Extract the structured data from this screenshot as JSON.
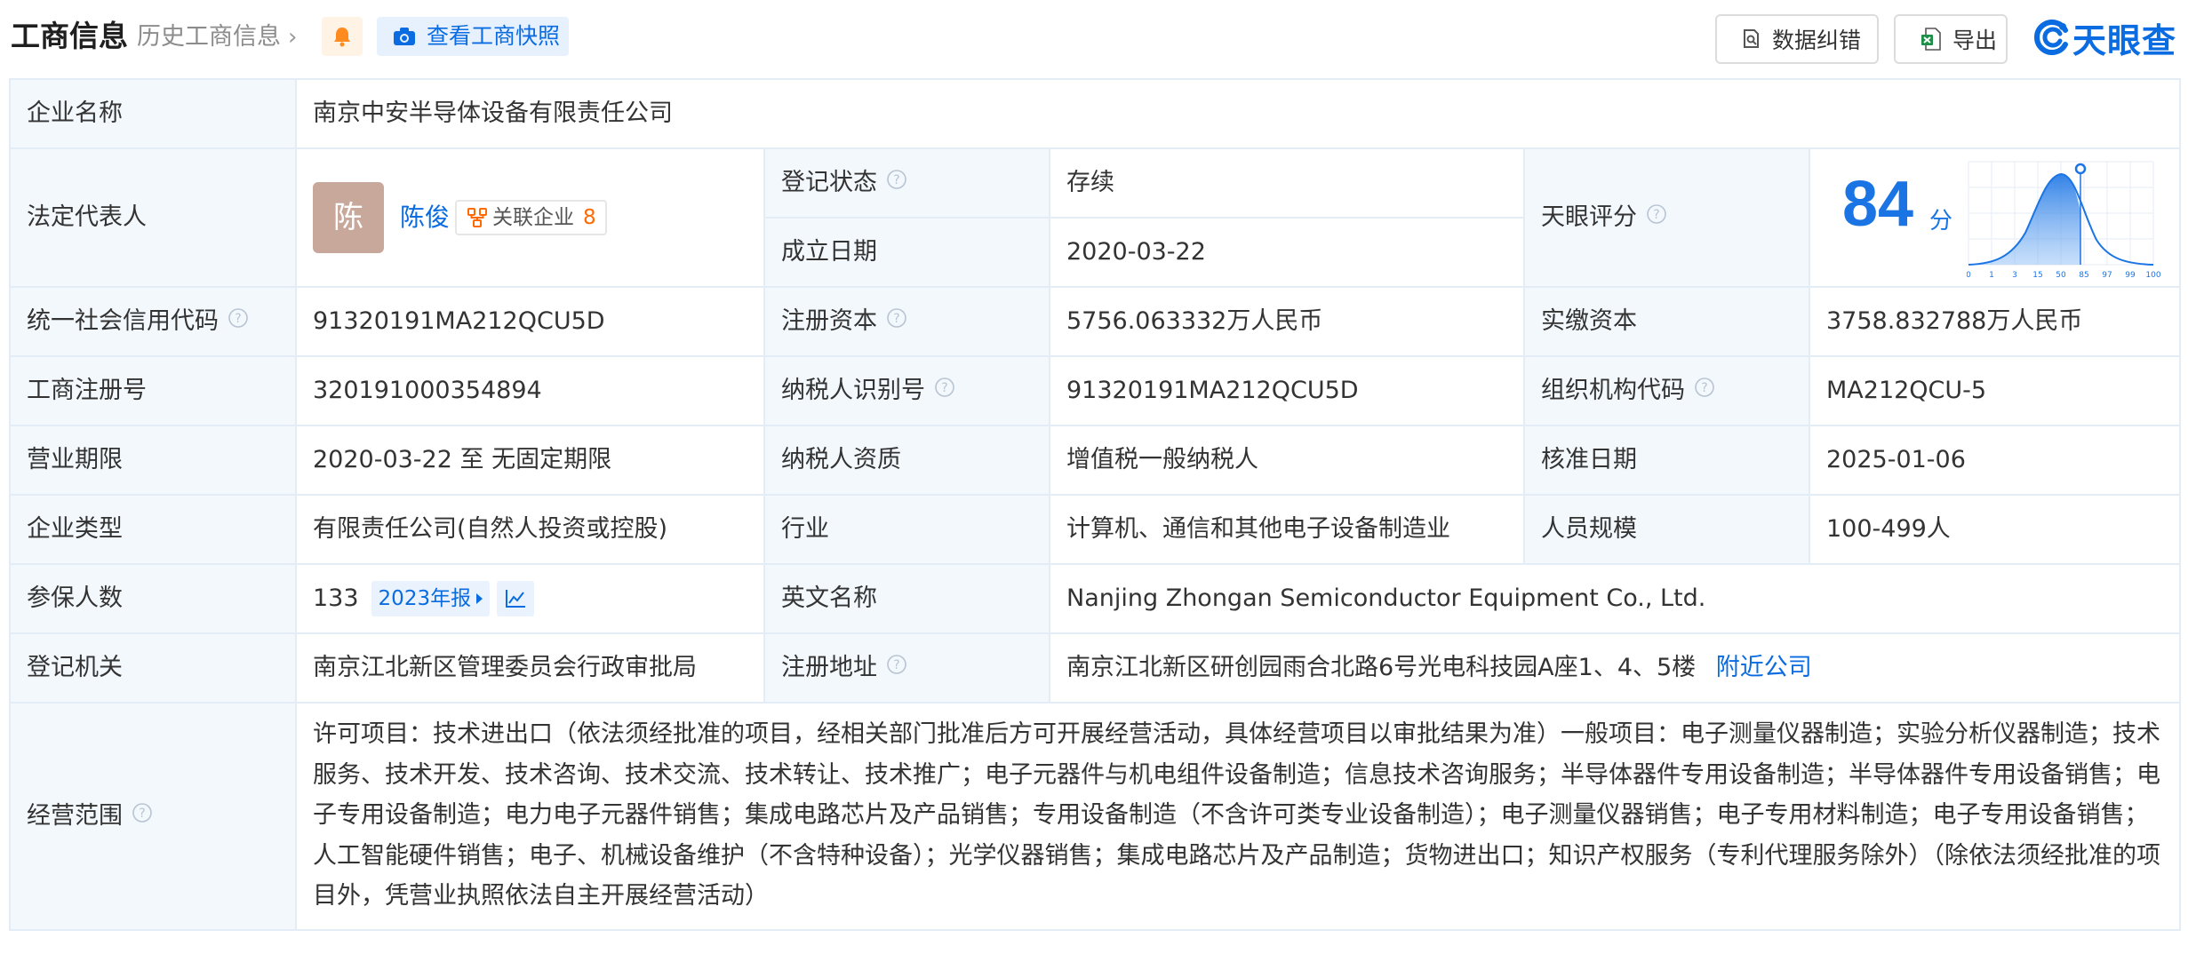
{
  "header": {
    "title": "工商信息",
    "history_link": "历史工商信息",
    "snapshot_button": "查看工商快照",
    "correct_button": "数据纠错",
    "export_button": "导出",
    "logo_text": "天眼查",
    "accent_color": "#0a6ce0",
    "icons": [
      "bell-icon",
      "camera-icon",
      "document-search-icon",
      "excel-icon",
      "tianyancha-logo-icon"
    ]
  },
  "company": {
    "name_label": "企业名称",
    "name": "南京中安半导体设备有限责任公司",
    "legal_rep_label": "法定代表人",
    "legal_rep_avatar": "陈",
    "legal_rep_name": "陈俊",
    "related_label": "关联企业",
    "related_count": "8",
    "reg_status_label": "登记状态",
    "reg_status": "存续",
    "found_date_label": "成立日期",
    "found_date": "2020-03-22",
    "score_label": "天眼评分",
    "score": "84",
    "score_unit": "分",
    "credit_code_label": "统一社会信用代码",
    "credit_code": "91320191MA212QCU5D",
    "reg_capital_label": "注册资本",
    "reg_capital": "5756.063332万人民币",
    "paid_capital_label": "实缴资本",
    "paid_capital": "3758.832788万人民币",
    "biz_reg_no_label": "工商注册号",
    "biz_reg_no": "320191000354894",
    "taxpayer_id_label": "纳税人识别号",
    "taxpayer_id": "91320191MA212QCU5D",
    "org_code_label": "组织机构代码",
    "org_code": "MA212QCU-5",
    "biz_term_label": "营业期限",
    "biz_term": "2020-03-22 至 无固定期限",
    "taxpayer_qual_label": "纳税人资质",
    "taxpayer_qual": "增值税一般纳税人",
    "approval_date_label": "核准日期",
    "approval_date": "2025-01-06",
    "company_type_label": "企业类型",
    "company_type": "有限责任公司(自然人投资或控股)",
    "industry_label": "行业",
    "industry": "计算机、通信和其他电子设备制造业",
    "staff_size_label": "人员规模",
    "staff_size": "100-499人",
    "insured_label": "参保人数",
    "insured_count": "133",
    "annual_report_tag": "2023年报",
    "english_name_label": "英文名称",
    "english_name": "Nanjing Zhongan Semiconductor Equipment Co., Ltd.",
    "reg_authority_label": "登记机关",
    "reg_authority": "南京江北新区管理委员会行政审批局",
    "reg_address_label": "注册地址",
    "reg_address": "南京江北新区研创园雨合北路6号光电科技园A座1、4、5楼",
    "nearby_link": "附近公司",
    "scope_label": "经营范围",
    "scope": "许可项目：技术进出口（依法须经批准的项目，经相关部门批准后方可开展经营活动，具体经营项目以审批结果为准）一般项目：电子测量仪器制造；实验分析仪器制造；技术服务、技术开发、技术咨询、技术交流、技术转让、技术推广；电子元器件与机电组件设备制造；信息技术咨询服务；半导体器件专用设备制造；半导体器件专用设备销售；电子专用设备制造；电力电子元器件销售；集成电路芯片及产品销售；专用设备制造（不含许可类专业设备制造）；电子测量仪器销售；电子专用材料制造；电子专用设备销售；人工智能硬件销售；电子、机械设备维护（不含特种设备）；光学仪器销售；集成电路芯片及产品制造；货物进出口；知识产权服务（专利代理服务除外）（除依法须经批准的项目外，凭营业执照依法自主开展经营活动）"
  },
  "score_chart": {
    "x_ticks": [
      "0",
      "1",
      "3",
      "15",
      "50",
      "85",
      "97",
      "99",
      "100"
    ],
    "marker_value": "84",
    "curve_color": "#1b74e4"
  }
}
